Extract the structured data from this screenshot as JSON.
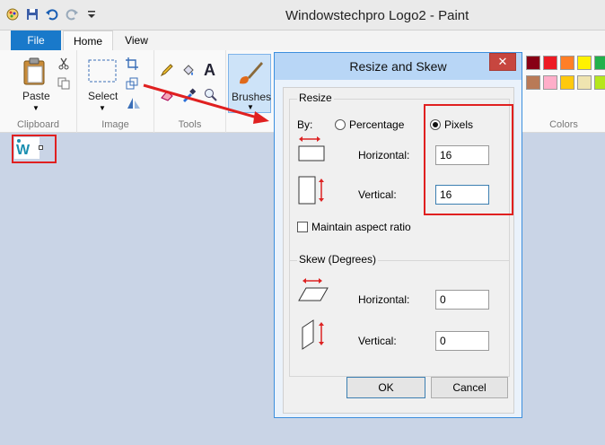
{
  "window": {
    "title": "Windowstechpro Logo2 - Paint"
  },
  "tabs": {
    "file": "File",
    "home": "Home",
    "view": "View"
  },
  "ribbon": {
    "paste_label": "Paste",
    "select_label": "Select",
    "brushes_label": "Brushes",
    "groups": {
      "clipboard": "Clipboard",
      "image": "Image",
      "tools": "Tools",
      "colors": "Colors"
    },
    "palette_row1": [
      "#880015",
      "#ed1c24",
      "#ff7f27",
      "#fff200",
      "#22b14c"
    ],
    "palette_row2": [
      "#b97a57",
      "#ffaec9",
      "#ffc90e",
      "#efe4b0",
      "#b5e61d"
    ]
  },
  "dialog": {
    "title": "Resize and Skew",
    "close_glyph": "✕",
    "resize": {
      "label": "Resize",
      "by_label": "By:",
      "percentage_label": "Percentage",
      "pixels_label": "Pixels",
      "selected": "Pixels",
      "horizontal_label": "Horizontal:",
      "horizontal_value": "16",
      "vertical_label": "Vertical:",
      "vertical_value": "16",
      "maintain_aspect_label": "Maintain aspect ratio",
      "maintain_aspect_checked": false
    },
    "skew": {
      "label": "Skew (Degrees)",
      "horizontal_label": "Horizontal:",
      "horizontal_value": "0",
      "vertical_label": "Vertical:",
      "vertical_value": "0"
    },
    "ok_label": "OK",
    "cancel_label": "Cancel"
  },
  "colors": {
    "highlight": "#e02020",
    "accent": "#1979ca"
  }
}
